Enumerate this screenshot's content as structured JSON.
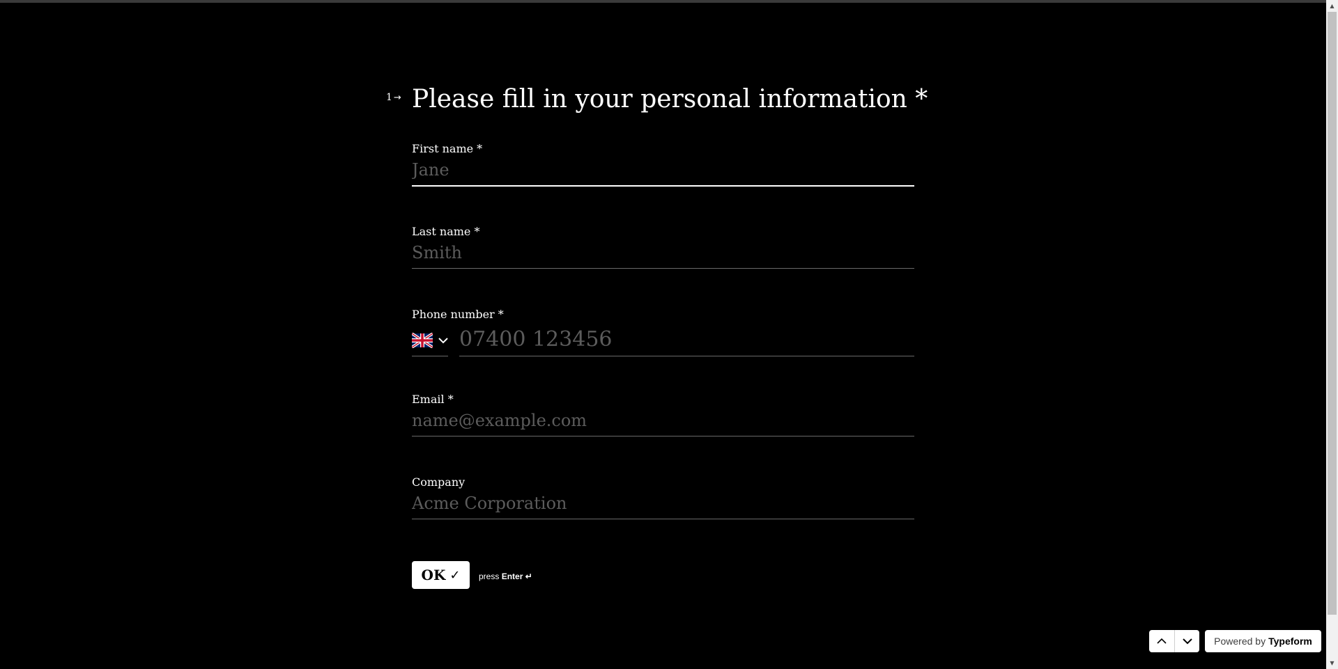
{
  "question": {
    "number": "1",
    "number_arrow": "→",
    "title": "Please fill in your personal information *"
  },
  "fields": {
    "first_name": {
      "label": "First name *",
      "placeholder": "Jane"
    },
    "last_name": {
      "label": "Last name *",
      "placeholder": "Smith"
    },
    "phone": {
      "label": "Phone number *",
      "placeholder": "07400 123456",
      "country": "United Kingdom"
    },
    "email": {
      "label": "Email *",
      "placeholder": "name@example.com"
    },
    "company": {
      "label": "Company",
      "placeholder": "Acme Corporation"
    }
  },
  "submit": {
    "label": "OK",
    "check_icon": "✓",
    "hint_prefix": "press",
    "hint_key": "Enter ↵"
  },
  "footer": {
    "powered_prefix": "Powered by",
    "powered_brand": "Typeform"
  },
  "scrollbar": {
    "up_arrow": "▲",
    "down_arrow": "▼"
  },
  "colors": {
    "background": "#000000",
    "text": "#ffffff",
    "placeholder": "#5c5c5c",
    "underline": "#6a6a6a"
  }
}
